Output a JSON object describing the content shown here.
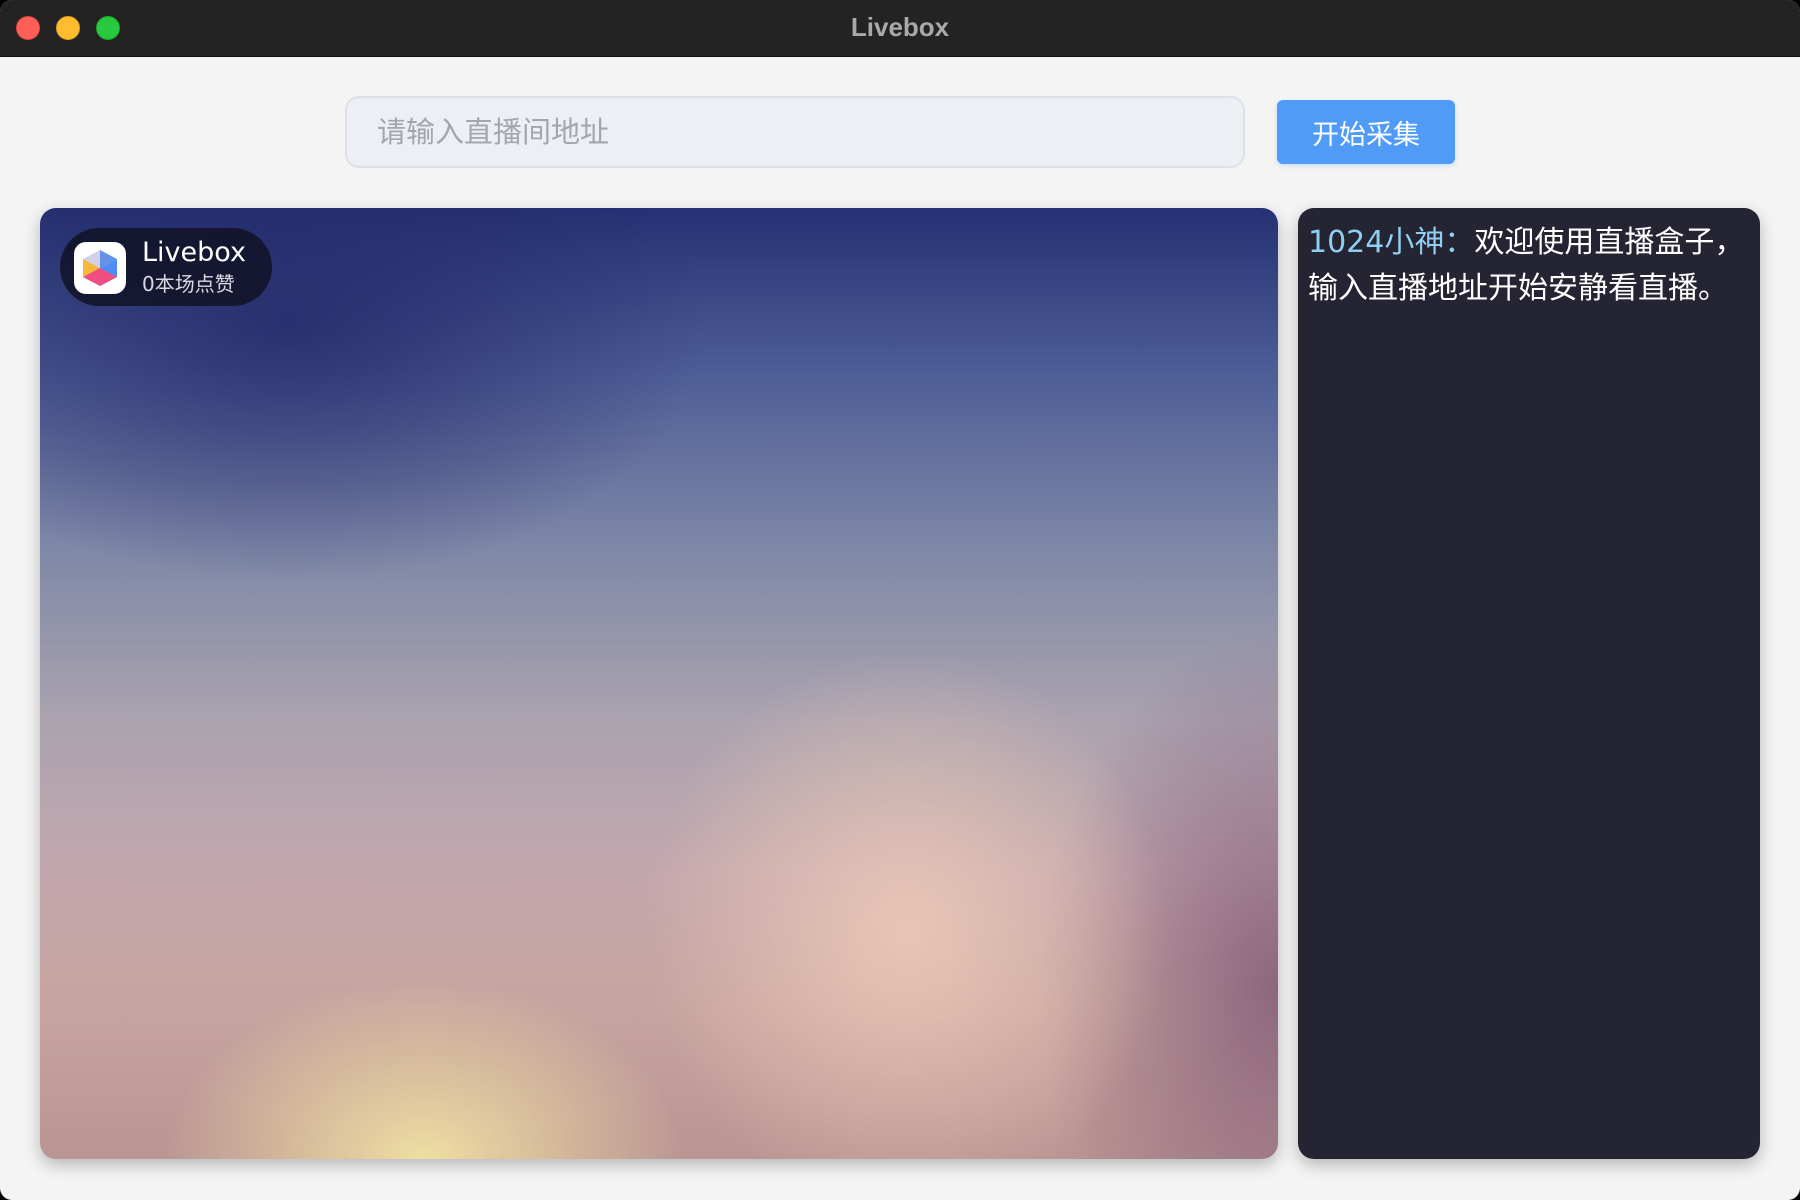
{
  "window": {
    "title": "Livebox"
  },
  "search": {
    "placeholder": "请输入直播间地址",
    "value": ""
  },
  "toolbar": {
    "start_label": "开始采集"
  },
  "live": {
    "app_name": "Livebox",
    "likes_text": "0本场点赞"
  },
  "comments": [
    {
      "user": "1024小神：",
      "text": "欢迎使用直播盒子，输入直播地址开始安静看直播。"
    }
  ],
  "colors": {
    "accent": "#4f9bf7",
    "comment_user": "#8fd0f2",
    "comments_background": "#242432"
  },
  "icons": {
    "app": "livebox-cube-icon"
  }
}
